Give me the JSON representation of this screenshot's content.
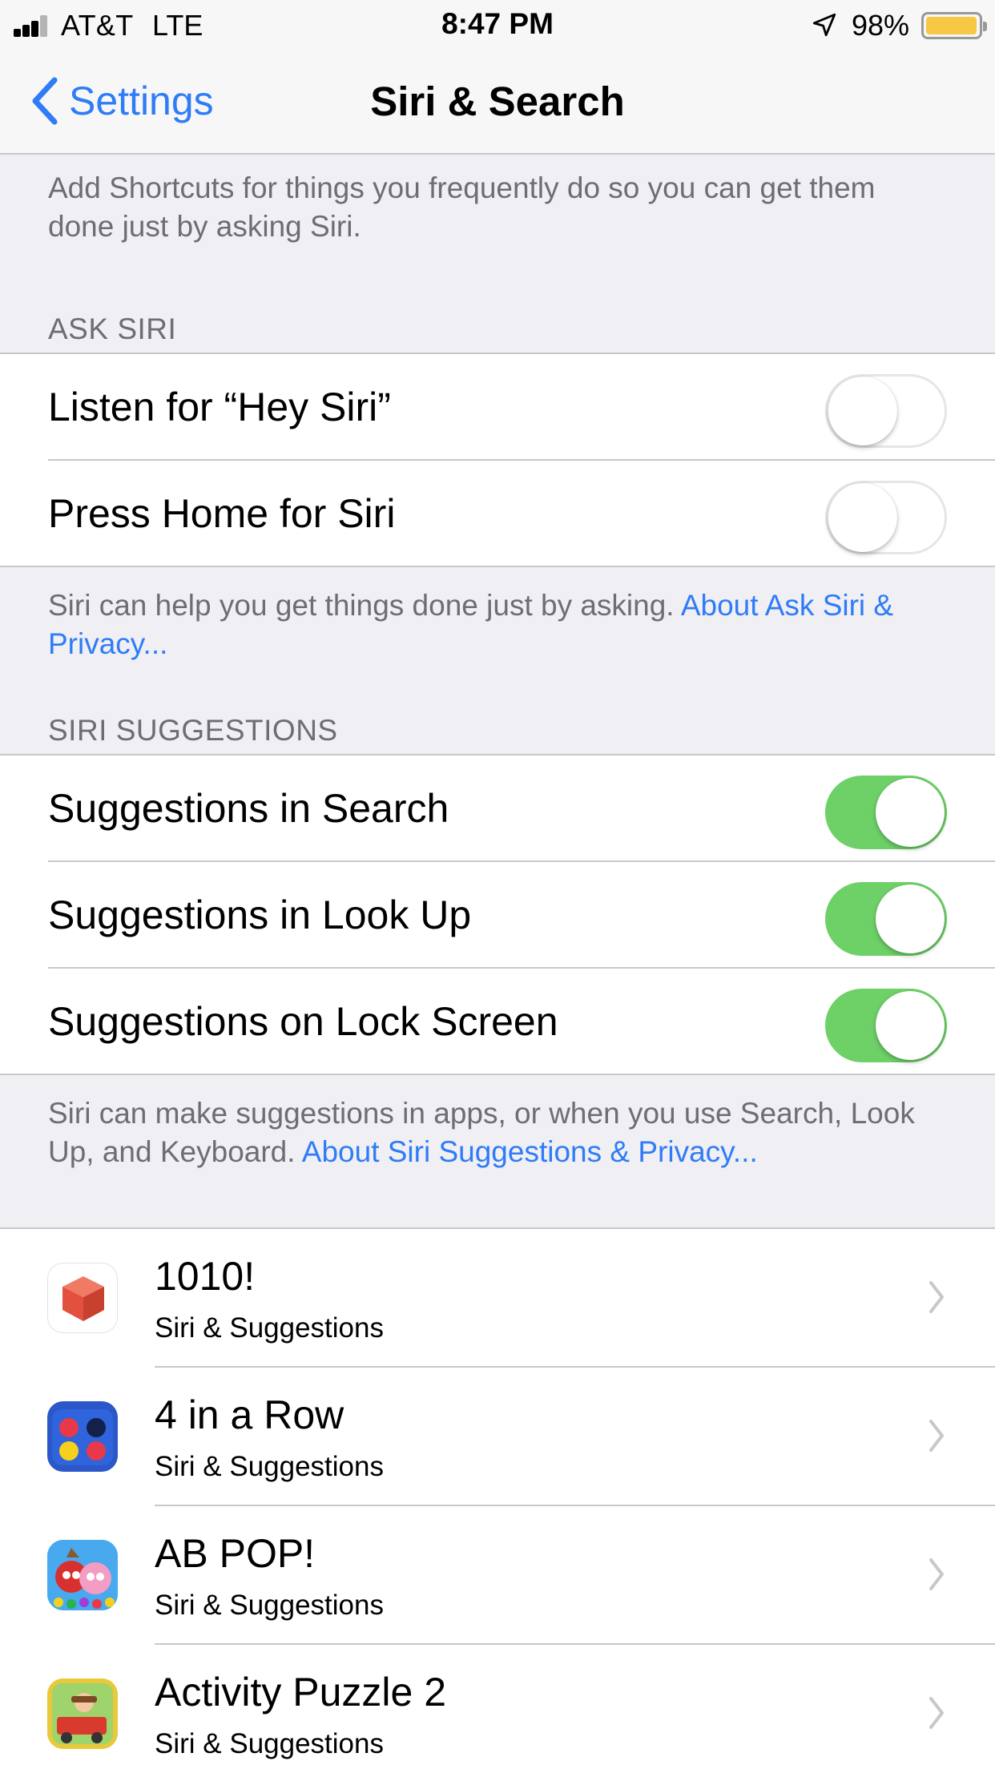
{
  "status_bar": {
    "carrier": "AT&T",
    "network": "LTE",
    "time": "8:47 PM",
    "battery_percent": "98%",
    "battery_level": 0.98,
    "battery_color": "#f7c844",
    "icons": [
      "signal-icon",
      "location-arrow-icon",
      "battery-icon"
    ]
  },
  "nav": {
    "back_label": "Settings",
    "title": "Siri & Search"
  },
  "intro_text": "Add Shortcuts for things you frequently do so you can get them done just by asking Siri.",
  "ask_siri": {
    "header": "ASK SIRI",
    "rows": [
      {
        "label": "Listen for “Hey Siri”",
        "on": false
      },
      {
        "label": "Press Home for Siri",
        "on": false
      }
    ],
    "footer_text": "Siri can help you get things done just by asking. ",
    "footer_link": "About Ask Siri & Privacy..."
  },
  "siri_suggestions": {
    "header": "SIRI SUGGESTIONS",
    "rows": [
      {
        "label": "Suggestions in Search",
        "on": true
      },
      {
        "label": "Suggestions in Look Up",
        "on": true
      },
      {
        "label": "Suggestions on Lock Screen",
        "on": true
      }
    ],
    "footer_text": "Siri can make suggestions in apps, or when you use Search, Look Up, and Keyboard. ",
    "footer_link": "About Siri Suggestions & Privacy..."
  },
  "apps": [
    {
      "name": "1010!",
      "subtitle": "Siri & Suggestions",
      "icon": "red-cube-app-icon"
    },
    {
      "name": "4 in a Row",
      "subtitle": "Siri & Suggestions",
      "icon": "four-in-a-row-app-icon"
    },
    {
      "name": "AB POP!",
      "subtitle": "Siri & Suggestions",
      "icon": "angry-birds-pop-app-icon"
    },
    {
      "name": "Activity Puzzle 2",
      "subtitle": "Siri & Suggestions",
      "icon": "activity-puzzle-app-icon"
    }
  ],
  "colors": {
    "accent": "#2f7cf6",
    "toggle_on": "#6dd167",
    "background": "#efeff4",
    "secondary_text": "#6d6d72"
  }
}
